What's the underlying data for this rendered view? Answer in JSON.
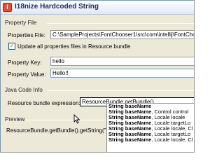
{
  "window": {
    "title": "I18nize Hardcoded String",
    "icon": "intellij-app-icon"
  },
  "property_file": {
    "section_label": "Property File",
    "properties_file_label": "Properties File:",
    "properties_file_value": "C:\\SampleProjects\\FontChooser1\\src\\com\\intellij\\FontChooser\\FontChooser1",
    "update_all_label": "Update all properties files in Resource bundle",
    "update_all_checked": true,
    "property_key_label": "Property Key:",
    "property_key_value": "hello",
    "property_value_label": "Property Value:",
    "property_value_value": "Hello!!"
  },
  "java_code_info": {
    "section_label": "Java Code Info",
    "resource_bundle_label": "Resource bundle expression:",
    "resource_bundle_value": "ResourceBundle.getBundle()"
  },
  "preview": {
    "section_label": "Preview",
    "text": "ResourceBundle.getBundle().getString(\"hello"
  },
  "completion_popup": {
    "items": [
      {
        "type": "String",
        "name": "baseName",
        "rest": ""
      },
      {
        "type": "String",
        "name": "baseName",
        "rest": ", Control control"
      },
      {
        "type": "String",
        "name": "baseName",
        "rest": ", Locale locale"
      },
      {
        "type": "String",
        "name": "baseName",
        "rest": ", Locale targetLo"
      },
      {
        "type": "String",
        "name": "baseName",
        "rest": ", Locale locale, Cl"
      },
      {
        "type": "String",
        "name": "baseName",
        "rest": ", Locale targetLo"
      },
      {
        "type": "String",
        "name": "baseName",
        "rest": ", Locale locale, Cl"
      }
    ]
  }
}
